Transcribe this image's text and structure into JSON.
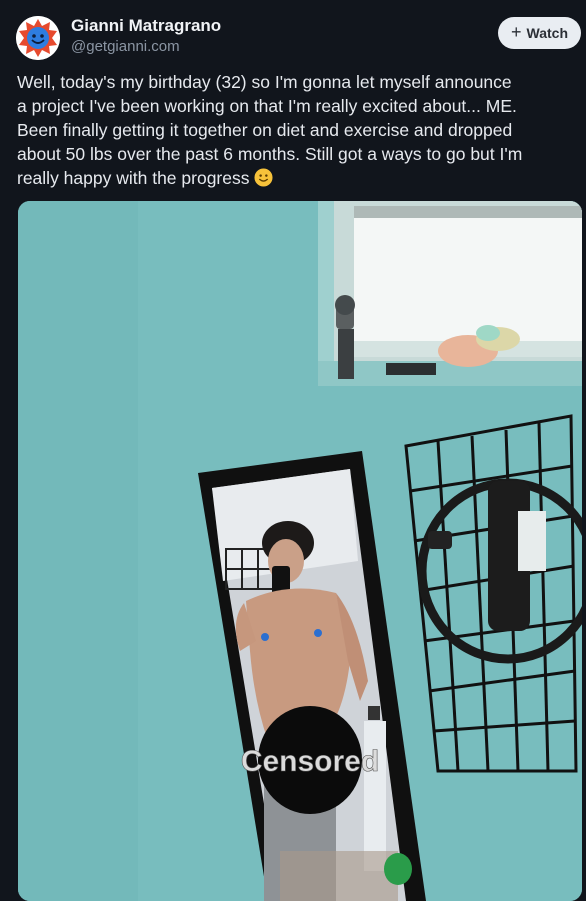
{
  "author": {
    "name": "Gianni Matragrano",
    "handle": "@getgianni.com",
    "avatar_icon": "smiley-badge-avatar"
  },
  "actions": {
    "watch_label": "Watch",
    "watch_icon": "plus-icon"
  },
  "post": {
    "lines": [
      "Well, today's my birthday (32) so I'm gonna let myself announce",
      "a project I've been working on that I'm really excited about... ME.",
      "Been finally getting it together on diet and exercise and dropped",
      "about 50 lbs over the past 6 months. Still got a ways to go but I'm",
      "really happy with the progress"
    ],
    "emoji": "slightly-smiling-face-icon"
  },
  "media": {
    "censor_label": "Censored",
    "colors": {
      "wall": "#77bcbd",
      "wall_shadow": "#5fa6a8",
      "frame": "#111111",
      "censor": "#0b0b0b"
    }
  }
}
